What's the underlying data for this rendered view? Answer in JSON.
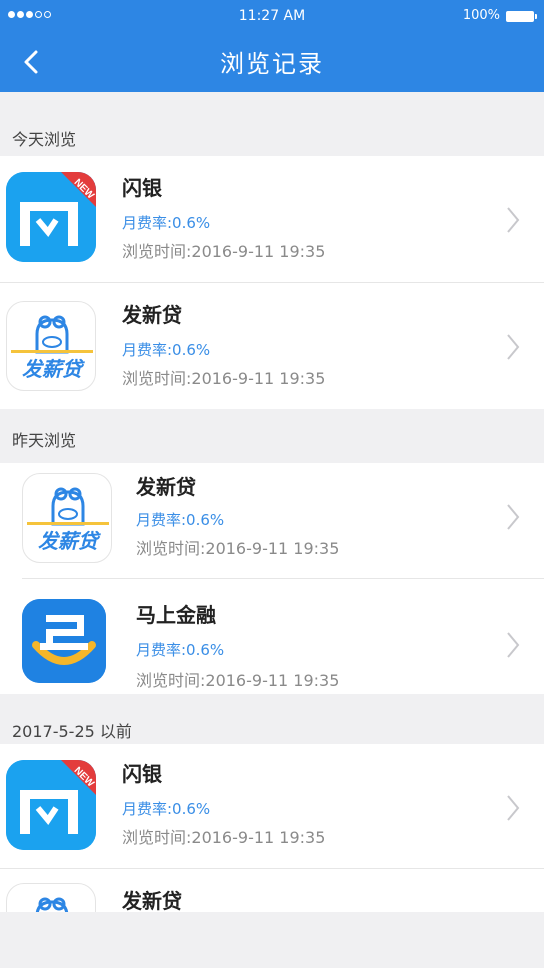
{
  "status": {
    "time": "11:27 AM",
    "battery": "100%"
  },
  "header": {
    "title": "浏览记录"
  },
  "sections": [
    {
      "label": "今天浏览"
    },
    {
      "label": "昨天浏览"
    },
    {
      "label": "2017-5-25 以前"
    }
  ],
  "items": [
    {
      "name": "闪银",
      "rate": "月费率:0.6%",
      "time": "浏览时间:2016-9-11 19:35",
      "logo": "shanyin-logo",
      "badge": "NEW"
    },
    {
      "name": "发新贷",
      "rate": "月费率:0.6%",
      "time": "浏览时间:2016-9-11 19:35",
      "logo": "faxindai-logo",
      "logo_text": "发薪贷"
    },
    {
      "name": "发新贷",
      "rate": "月费率:0.6%",
      "time": "浏览时间:2016-9-11 19:35",
      "logo": "faxindai-logo",
      "logo_text": "发薪贷"
    },
    {
      "name": "马上金融",
      "rate": "月费率:0.6%",
      "time": "浏览时间:2016-9-11 19:35",
      "logo": "mashang-logo"
    },
    {
      "name": "闪银",
      "rate": "月费率:0.6%",
      "time": "浏览时间:2016-9-11 19:35",
      "logo": "shanyin-logo",
      "badge": "NEW"
    },
    {
      "name": "发新贷",
      "logo": "faxindai-logo"
    }
  ],
  "colors": {
    "header": "#2d86e4",
    "rate": "#3a8ee6",
    "background": "#f0f0f2"
  }
}
